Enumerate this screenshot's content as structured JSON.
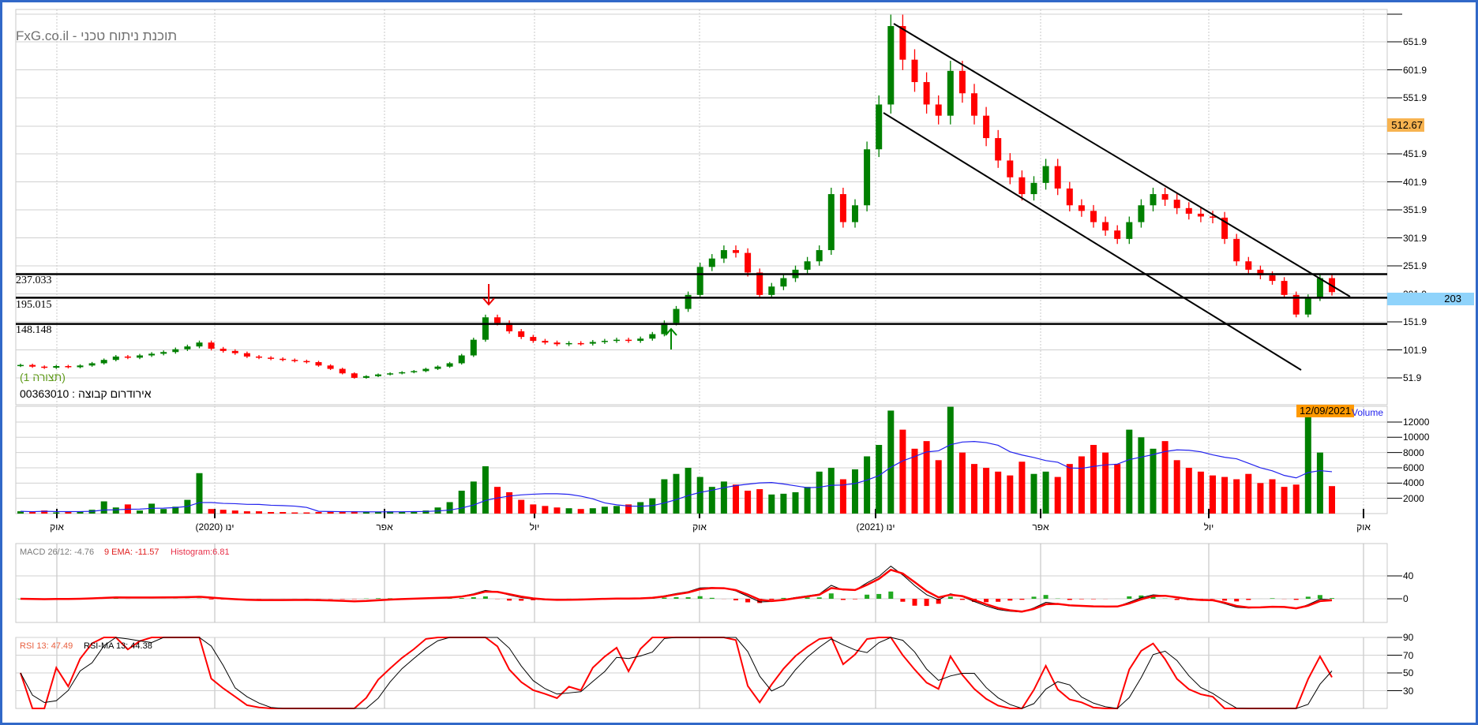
{
  "header": {
    "title": "FxG.co.il - תוכנת ניתוח טכני",
    "layout_label": "(תצורה 1)",
    "instrument": "00363010 : אירודרום קבוצה"
  },
  "price_panel": {
    "levels": [
      "237.033",
      "195.015",
      "148.148"
    ],
    "axis_labels": [
      "651.9",
      "601.9",
      "551.9",
      "451.9",
      "401.9",
      "351.9",
      "301.9",
      "251.9",
      "201.9",
      "151.9",
      "101.9",
      "51.9"
    ],
    "crosshair_price": "512.67",
    "last_price": "203"
  },
  "volume_panel": {
    "label": "Volume",
    "date_tooltip": "12/09/2021",
    "axis_labels": [
      "12000",
      "10000",
      "8000",
      "6000",
      "4000",
      "2000"
    ]
  },
  "x_axis": {
    "labels": [
      "אוק",
      "ינו (2020)",
      "אפר",
      "יול",
      "אוק",
      "ינו (2021)",
      "אפר",
      "יול",
      "אוק"
    ]
  },
  "macd_panel": {
    "macd_label": "MACD 26/12: -4.76",
    "ema_label": "9 EMA: -11.57",
    "histogram_label": "Histogram:6.81",
    "axis_labels": [
      "40",
      "0"
    ]
  },
  "rsi_panel": {
    "rsi_label": "RSI 13: 47.49",
    "rsi_ma_label": "RSI-MA 13: 44.38",
    "axis_labels": [
      "90",
      "70",
      "50",
      "30"
    ]
  },
  "colors": {
    "up": "#008000",
    "down": "#ff0000",
    "volume_ma": "#2222ee",
    "frame": "#3168c8"
  },
  "chart_data": {
    "type": "candlestick",
    "title": "00363010 : אירודרום קבוצה",
    "period": "2019-08 to 2021-09-12 (approx. weekly sampling)",
    "ylim": [
      30,
      700
    ],
    "closes": [
      75,
      72,
      70,
      73,
      71,
      74,
      78,
      84,
      90,
      88,
      92,
      95,
      98,
      103,
      108,
      115,
      104,
      100,
      96,
      90,
      88,
      86,
      84,
      82,
      80,
      74,
      68,
      60,
      52,
      55,
      58,
      60,
      62,
      64,
      68,
      72,
      78,
      92,
      120,
      160,
      150,
      135,
      125,
      118,
      115,
      112,
      114,
      113,
      116,
      118,
      120,
      118,
      122,
      130,
      150,
      175,
      200,
      250,
      265,
      280,
      275,
      240,
      200,
      215,
      230,
      245,
      260,
      280,
      380,
      330,
      360,
      460,
      540,
      680,
      620,
      580,
      540,
      520,
      600,
      560,
      520,
      480,
      440,
      410,
      380,
      400,
      430,
      390,
      360,
      350,
      330,
      315,
      300,
      330,
      360,
      380,
      370,
      355,
      345,
      340,
      338,
      300,
      260,
      245,
      235,
      225,
      200,
      165,
      195,
      230,
      205
    ],
    "volumes": [
      300,
      200,
      400,
      150,
      250,
      300,
      500,
      1600,
      800,
      1200,
      400,
      1300,
      600,
      900,
      1800,
      5300,
      600,
      500,
      400,
      300,
      300,
      200,
      200,
      150,
      150,
      200,
      300,
      300,
      300,
      250,
      200,
      300,
      250,
      300,
      400,
      800,
      1500,
      3000,
      4200,
      6200,
      3500,
      2800,
      1800,
      1200,
      1000,
      800,
      700,
      600,
      700,
      900,
      1000,
      1200,
      1500,
      2000,
      4500,
      5200,
      6000,
      4800,
      3500,
      4200,
      3800,
      3000,
      3200,
      2500,
      2600,
      2800,
      3500,
      5500,
      6000,
      4500,
      5800,
      7500,
      9000,
      13500,
      11000,
      8500,
      9500,
      7000,
      14000,
      8000,
      6500,
      6000,
      5500,
      5000,
      6800,
      5200,
      5500,
      4800,
      6500,
      7500,
      9000,
      8000,
      6500,
      11000,
      10000,
      8500,
      9500,
      7000,
      6000,
      5500,
      5000,
      4800,
      4500,
      5200,
      4000,
      4500,
      3500,
      3800,
      13000,
      8000,
      3600
    ],
    "horizontal_levels": [
      237.033,
      195.015,
      148.148
    ],
    "volume_ma_period": 10,
    "macd": {
      "fast": 12,
      "slow": 26,
      "signal": 9,
      "ylim": [
        -41,
        96
      ]
    },
    "rsi": {
      "period": 13,
      "ma_period": 13,
      "ylim": [
        10,
        90
      ]
    }
  }
}
